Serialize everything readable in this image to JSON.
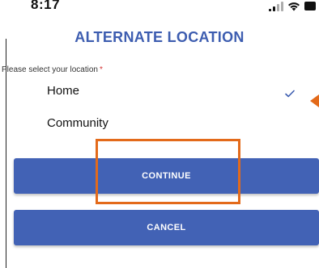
{
  "status_bar": {
    "time": "8:17",
    "icons": [
      "signal-icon",
      "wifi-icon",
      "battery-icon"
    ]
  },
  "page": {
    "title": "ALTERNATE LOCATION"
  },
  "location_field": {
    "label": "Please select your location",
    "required_mark": "*",
    "options": [
      {
        "label": "Home",
        "selected": true
      },
      {
        "label": "Community",
        "selected": false
      }
    ]
  },
  "actions": {
    "continue_label": "CONTINUE",
    "cancel_label": "CANCEL"
  },
  "colors": {
    "title": "#3d5db0",
    "button": "#4262b5",
    "annotation": "#e36a1a",
    "required": "#d32f2f"
  },
  "annotation": {
    "highlight_target": "continue-button"
  }
}
